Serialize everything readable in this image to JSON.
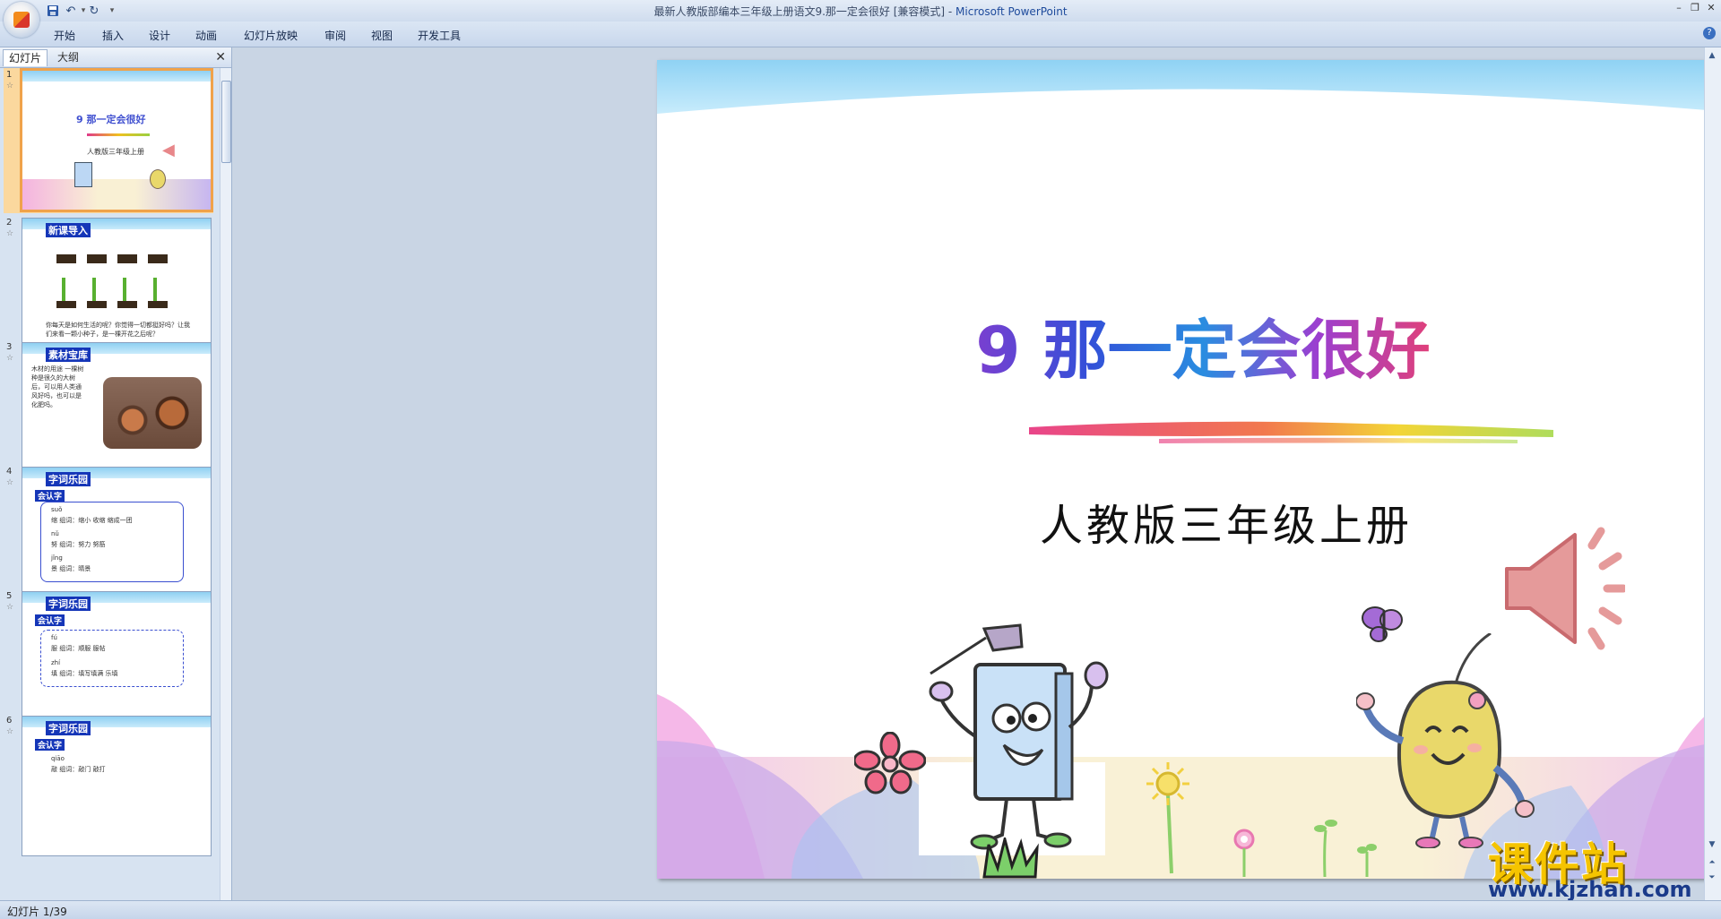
{
  "window": {
    "title": "最新人教版部编本三年级上册语文9.那一定会很好 [兼容模式]",
    "separator": " - ",
    "app_name": "Microsoft PowerPoint"
  },
  "ribbon": {
    "tabs": [
      "开始",
      "插入",
      "设计",
      "动画",
      "幻灯片放映",
      "审阅",
      "视图",
      "开发工具"
    ]
  },
  "panel": {
    "tab_slides": "幻灯片",
    "tab_outline": "大纲",
    "close": "✕"
  },
  "thumbnails": [
    {
      "num": "1",
      "title": "9 那一定会很好",
      "subtitle": "人教版三年级上册"
    },
    {
      "num": "2",
      "title": "新课导入",
      "text": "你每天是如何生活的呢？你觉得一切都挺好吗？让我们来看一颗小种子，是一棵开花之后呢？"
    },
    {
      "num": "3",
      "title": "素材宝库",
      "text": "木材的用途 一棵树种是很久的大树后，可以用人类通风好吗，也可以是化肥吗。"
    },
    {
      "num": "4",
      "title": "字词乐园",
      "label": "会认字",
      "rows": [
        "suǒ",
        "缩  组词：缩小  收缩  缩成一团",
        "nǔ",
        "努  组词：努力  努筋",
        "jǐng",
        "景  组词：晴景"
      ]
    },
    {
      "num": "5",
      "title": "字词乐园",
      "label": "会认字",
      "rows": [
        "fú",
        "服  组词：顺服  服帖",
        "zhí",
        "填  组词：填写填满  乐填"
      ]
    },
    {
      "num": "6",
      "title": "字词乐园",
      "label": "会认字",
      "rows": [
        "qiāo",
        "敲  组词：敲门  敲打"
      ]
    }
  ],
  "slide": {
    "title": "9 那一定会很好",
    "subtitle": "人教版三年级上册"
  },
  "status": {
    "text": "幻灯片 1/39"
  },
  "watermark": {
    "title": "课件站",
    "url": "www.kjzhan.com"
  },
  "colors": {
    "title_gradient": [
      "#7a3fd0",
      "#3350d8",
      "#2a8de0",
      "#e0407a"
    ],
    "thumb_selected": "#f0a24a",
    "ribbon_bg": "#c8d7ec",
    "watermark_yellow": "#f5c400"
  }
}
